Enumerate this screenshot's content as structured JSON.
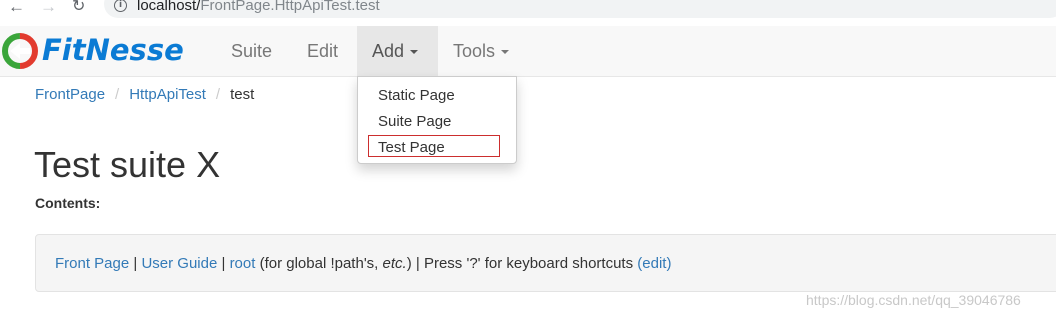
{
  "browser": {
    "url_host": "localhost/",
    "url_path": "FrontPage.HttpApiTest.test"
  },
  "navbar": {
    "brand": "FitNesse",
    "items": [
      {
        "label": "Suite"
      },
      {
        "label": "Edit"
      },
      {
        "label": "Add",
        "active": true
      },
      {
        "label": "Tools"
      }
    ]
  },
  "dropdown": {
    "items": [
      {
        "label": "Static Page"
      },
      {
        "label": "Suite Page"
      },
      {
        "label": "Test Page",
        "highlighted": true
      }
    ]
  },
  "breadcrumb": {
    "items": [
      "FrontPage",
      "HttpApiTest"
    ],
    "current": "test",
    "separator": "/"
  },
  "page": {
    "title": "Test suite X",
    "contents_label": "Contents:"
  },
  "footer": {
    "link_front_page": "Front Page",
    "sep1": " | ",
    "link_user_guide": "User Guide",
    "sep2": " | ",
    "link_root": "root",
    "text_global_pre": " (for global !path's, ",
    "text_etc": "etc.",
    "text_global_post": ") | Press '?' for keyboard shortcuts ",
    "link_edit": "(edit)"
  },
  "watermark": "https://blog.csdn.net/qq_39046786",
  "colors": {
    "brand": "#0b7bd4",
    "link": "#337ab7",
    "highlight_border": "#cc2e2e",
    "navbar_bg": "#f8f8f8"
  }
}
